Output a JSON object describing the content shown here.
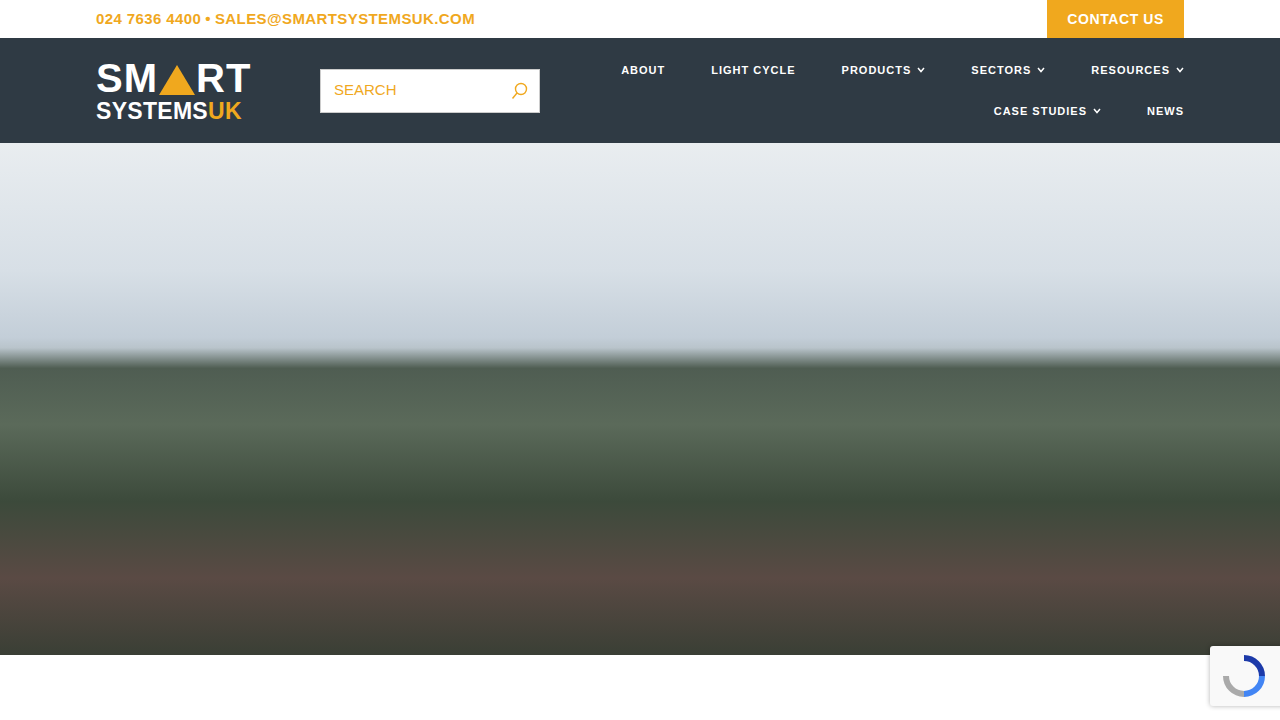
{
  "topbar": {
    "phone": "024 7636 4400",
    "separator": "•",
    "email": "SALES@SMARTSYSTEMSUK.COM",
    "contact_button": "CONTACT US"
  },
  "logo": {
    "line1_left": "SM",
    "line1_right": "RT",
    "line2": "SYSTEMS",
    "line2_accent": "UK"
  },
  "search": {
    "placeholder": "SEARCH"
  },
  "menu": [
    [
      {
        "label": "ABOUT",
        "dropdown": false
      },
      {
        "label": "LIGHT CYCLE",
        "dropdown": false
      },
      {
        "label": "PRODUCTS",
        "dropdown": true
      },
      {
        "label": "SECTORS",
        "dropdown": true
      },
      {
        "label": "RESOURCES",
        "dropdown": true
      }
    ],
    [
      {
        "label": "CASE STUDIES",
        "dropdown": true
      },
      {
        "label": "NEWS",
        "dropdown": false
      }
    ]
  ]
}
